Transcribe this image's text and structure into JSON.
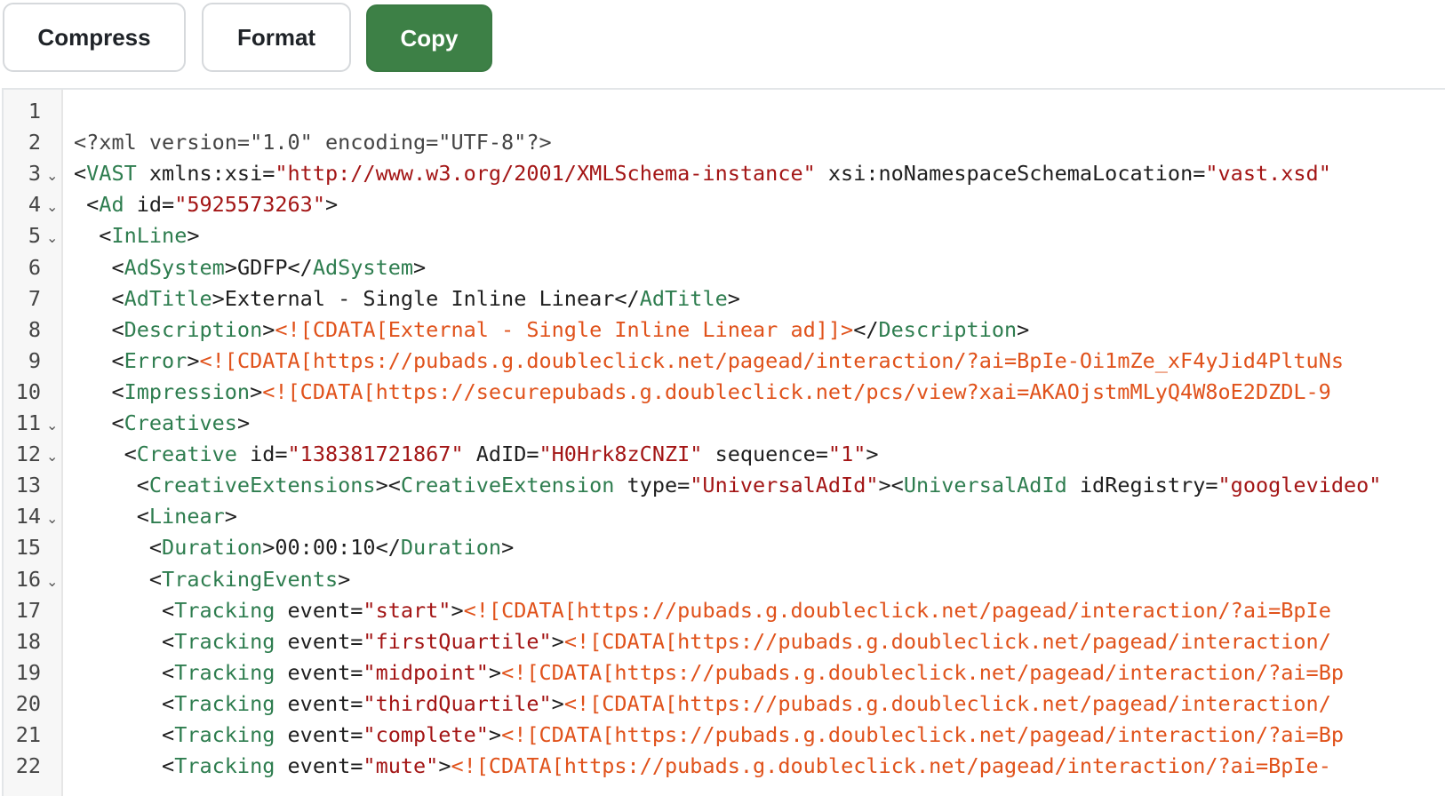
{
  "toolbar": {
    "compress_label": "Compress",
    "format_label": "Format",
    "copy_label": "Copy"
  },
  "colors": {
    "primary_button": "#3d8046",
    "tag": "#2e7d4f",
    "attr_value": "#a31515",
    "cdata": "#e0521b"
  },
  "editor": {
    "fold_icon": "chevron-down-icon",
    "lines": [
      {
        "num": "1",
        "fold": false,
        "tokens": []
      },
      {
        "num": "2",
        "fold": false,
        "tokens": [
          {
            "k": "pi",
            "s": "<?xml version=\"1.0\" encoding=\"UTF-8\"?>"
          }
        ]
      },
      {
        "num": "3",
        "fold": true,
        "tokens": [
          {
            "k": "p",
            "s": "<"
          },
          {
            "k": "t",
            "s": "VAST"
          },
          {
            "k": "a",
            "s": " xmlns:xsi="
          },
          {
            "k": "v",
            "s": "\"http://www.w3.org/2001/XMLSchema-instance\""
          },
          {
            "k": "a",
            "s": " xsi:noNamespaceSchemaLocation="
          },
          {
            "k": "v",
            "s": "\"vast.xsd\""
          }
        ]
      },
      {
        "num": "4",
        "fold": true,
        "tokens": [
          {
            "k": "p",
            "s": " <"
          },
          {
            "k": "t",
            "s": "Ad"
          },
          {
            "k": "a",
            "s": " id="
          },
          {
            "k": "v",
            "s": "\"5925573263\""
          },
          {
            "k": "p",
            "s": ">"
          }
        ]
      },
      {
        "num": "5",
        "fold": true,
        "tokens": [
          {
            "k": "p",
            "s": "  <"
          },
          {
            "k": "t",
            "s": "InLine"
          },
          {
            "k": "p",
            "s": ">"
          }
        ]
      },
      {
        "num": "6",
        "fold": false,
        "tokens": [
          {
            "k": "p",
            "s": "   <"
          },
          {
            "k": "t",
            "s": "AdSystem"
          },
          {
            "k": "p",
            "s": ">"
          },
          {
            "k": "tx",
            "s": "GDFP"
          },
          {
            "k": "p",
            "s": "</"
          },
          {
            "k": "t",
            "s": "AdSystem"
          },
          {
            "k": "p",
            "s": ">"
          }
        ]
      },
      {
        "num": "7",
        "fold": false,
        "tokens": [
          {
            "k": "p",
            "s": "   <"
          },
          {
            "k": "t",
            "s": "AdTitle"
          },
          {
            "k": "p",
            "s": ">"
          },
          {
            "k": "tx",
            "s": "External - Single Inline Linear"
          },
          {
            "k": "p",
            "s": "</"
          },
          {
            "k": "t",
            "s": "AdTitle"
          },
          {
            "k": "p",
            "s": ">"
          }
        ]
      },
      {
        "num": "8",
        "fold": false,
        "tokens": [
          {
            "k": "p",
            "s": "   <"
          },
          {
            "k": "t",
            "s": "Description"
          },
          {
            "k": "p",
            "s": ">"
          },
          {
            "k": "c",
            "s": "<![CDATA[External - Single Inline Linear ad]]>"
          },
          {
            "k": "p",
            "s": "</"
          },
          {
            "k": "t",
            "s": "Description"
          },
          {
            "k": "p",
            "s": ">"
          }
        ]
      },
      {
        "num": "9",
        "fold": false,
        "tokens": [
          {
            "k": "p",
            "s": "   <"
          },
          {
            "k": "t",
            "s": "Error"
          },
          {
            "k": "p",
            "s": ">"
          },
          {
            "k": "c",
            "s": "<![CDATA[https://pubads.g.doubleclick.net/pagead/interaction/?ai=BpIe-Oi1mZe_xF4yJid4PltuNs"
          }
        ]
      },
      {
        "num": "10",
        "fold": false,
        "tokens": [
          {
            "k": "p",
            "s": "   <"
          },
          {
            "k": "t",
            "s": "Impression"
          },
          {
            "k": "p",
            "s": ">"
          },
          {
            "k": "c",
            "s": "<![CDATA[https://securepubads.g.doubleclick.net/pcs/view?xai=AKAOjstmMLyQ4W8oE2DZDL-9"
          }
        ]
      },
      {
        "num": "11",
        "fold": true,
        "tokens": [
          {
            "k": "p",
            "s": "   <"
          },
          {
            "k": "t",
            "s": "Creatives"
          },
          {
            "k": "p",
            "s": ">"
          }
        ]
      },
      {
        "num": "12",
        "fold": true,
        "tokens": [
          {
            "k": "p",
            "s": "    <"
          },
          {
            "k": "t",
            "s": "Creative"
          },
          {
            "k": "a",
            "s": " id="
          },
          {
            "k": "v",
            "s": "\"138381721867\""
          },
          {
            "k": "a",
            "s": " AdID="
          },
          {
            "k": "v",
            "s": "\"H0Hrk8zCNZI\""
          },
          {
            "k": "a",
            "s": " sequence="
          },
          {
            "k": "v",
            "s": "\"1\""
          },
          {
            "k": "p",
            "s": ">"
          }
        ]
      },
      {
        "num": "13",
        "fold": false,
        "tokens": [
          {
            "k": "p",
            "s": "     <"
          },
          {
            "k": "t",
            "s": "CreativeExtensions"
          },
          {
            "k": "p",
            "s": "><"
          },
          {
            "k": "t",
            "s": "CreativeExtension"
          },
          {
            "k": "a",
            "s": " type="
          },
          {
            "k": "v",
            "s": "\"UniversalAdId\""
          },
          {
            "k": "p",
            "s": "><"
          },
          {
            "k": "t",
            "s": "UniversalAdId"
          },
          {
            "k": "a",
            "s": " idRegistry="
          },
          {
            "k": "v",
            "s": "\"googlevideo\""
          }
        ]
      },
      {
        "num": "14",
        "fold": true,
        "tokens": [
          {
            "k": "p",
            "s": "     <"
          },
          {
            "k": "t",
            "s": "Linear"
          },
          {
            "k": "p",
            "s": ">"
          }
        ]
      },
      {
        "num": "15",
        "fold": false,
        "tokens": [
          {
            "k": "p",
            "s": "      <"
          },
          {
            "k": "t",
            "s": "Duration"
          },
          {
            "k": "p",
            "s": ">"
          },
          {
            "k": "tx",
            "s": "00:00:10"
          },
          {
            "k": "p",
            "s": "</"
          },
          {
            "k": "t",
            "s": "Duration"
          },
          {
            "k": "p",
            "s": ">"
          }
        ]
      },
      {
        "num": "16",
        "fold": true,
        "tokens": [
          {
            "k": "p",
            "s": "      <"
          },
          {
            "k": "t",
            "s": "TrackingEvents"
          },
          {
            "k": "p",
            "s": ">"
          }
        ]
      },
      {
        "num": "17",
        "fold": false,
        "tokens": [
          {
            "k": "p",
            "s": "       <"
          },
          {
            "k": "t",
            "s": "Tracking"
          },
          {
            "k": "a",
            "s": " event="
          },
          {
            "k": "v",
            "s": "\"start\""
          },
          {
            "k": "p",
            "s": ">"
          },
          {
            "k": "c",
            "s": "<![CDATA[https://pubads.g.doubleclick.net/pagead/interaction/?ai=BpIe"
          }
        ]
      },
      {
        "num": "18",
        "fold": false,
        "tokens": [
          {
            "k": "p",
            "s": "       <"
          },
          {
            "k": "t",
            "s": "Tracking"
          },
          {
            "k": "a",
            "s": " event="
          },
          {
            "k": "v",
            "s": "\"firstQuartile\""
          },
          {
            "k": "p",
            "s": ">"
          },
          {
            "k": "c",
            "s": "<![CDATA[https://pubads.g.doubleclick.net/pagead/interaction/"
          }
        ]
      },
      {
        "num": "19",
        "fold": false,
        "tokens": [
          {
            "k": "p",
            "s": "       <"
          },
          {
            "k": "t",
            "s": "Tracking"
          },
          {
            "k": "a",
            "s": " event="
          },
          {
            "k": "v",
            "s": "\"midpoint\""
          },
          {
            "k": "p",
            "s": ">"
          },
          {
            "k": "c",
            "s": "<![CDATA[https://pubads.g.doubleclick.net/pagead/interaction/?ai=Bp"
          }
        ]
      },
      {
        "num": "20",
        "fold": false,
        "tokens": [
          {
            "k": "p",
            "s": "       <"
          },
          {
            "k": "t",
            "s": "Tracking"
          },
          {
            "k": "a",
            "s": " event="
          },
          {
            "k": "v",
            "s": "\"thirdQuartile\""
          },
          {
            "k": "p",
            "s": ">"
          },
          {
            "k": "c",
            "s": "<![CDATA[https://pubads.g.doubleclick.net/pagead/interaction/"
          }
        ]
      },
      {
        "num": "21",
        "fold": false,
        "tokens": [
          {
            "k": "p",
            "s": "       <"
          },
          {
            "k": "t",
            "s": "Tracking"
          },
          {
            "k": "a",
            "s": " event="
          },
          {
            "k": "v",
            "s": "\"complete\""
          },
          {
            "k": "p",
            "s": ">"
          },
          {
            "k": "c",
            "s": "<![CDATA[https://pubads.g.doubleclick.net/pagead/interaction/?ai=Bp"
          }
        ]
      },
      {
        "num": "22",
        "fold": false,
        "tokens": [
          {
            "k": "p",
            "s": "       <"
          },
          {
            "k": "t",
            "s": "Tracking"
          },
          {
            "k": "a",
            "s": " event="
          },
          {
            "k": "v",
            "s": "\"mute\""
          },
          {
            "k": "p",
            "s": ">"
          },
          {
            "k": "c",
            "s": "<![CDATA[https://pubads.g.doubleclick.net/pagead/interaction/?ai=BpIe-"
          }
        ]
      }
    ]
  }
}
